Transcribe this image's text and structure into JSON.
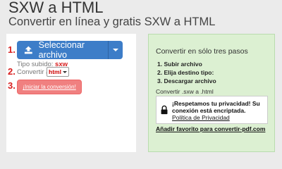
{
  "header": {
    "title": "SXW a HTML",
    "subtitle": "Convertir en línea y gratis SXW a HTML"
  },
  "converter": {
    "step1_number": "1.",
    "step2_number": "2.",
    "step3_number": "3.",
    "select_button_label": "Seleccionar archivo",
    "type_label": "Tipo subido:",
    "type_value": "sxw",
    "convert_to_label": "Convertir a:",
    "convert_to_value": "html",
    "convert_button_label": "¡Iniciar la conversión!"
  },
  "info": {
    "title": "Convertir en sólo tres pasos",
    "steps": [
      "Subir archivo",
      "Elija destino tipo:",
      "Descargar archivo"
    ],
    "convert_note": "Convertir .sxw a .html",
    "privacy_heading": "¡Respetamos tu privacidad! Su conexión está encriptada.",
    "privacy_link": "Política de Privacidad",
    "favorite_link": "Añadir favorito para convertir-pdf.com"
  },
  "colors": {
    "primary_button": "#3d7dc8",
    "convert_button": "#f08080",
    "step_number": "#d81e1e",
    "info_panel_bg": "#dcf0d2"
  },
  "icons": {
    "upload": "upload-icon",
    "dropdown": "chevron-down-icon",
    "lock": "lock-icon"
  }
}
